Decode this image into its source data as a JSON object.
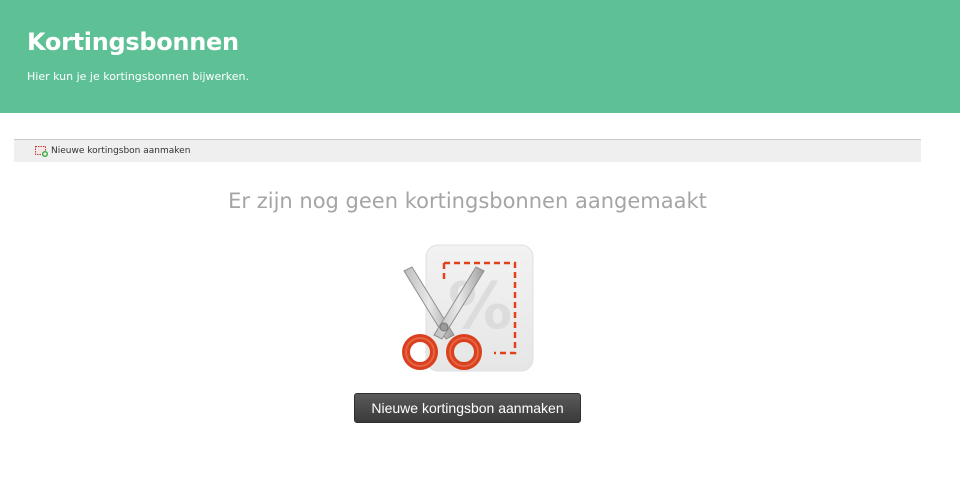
{
  "header": {
    "title": "Kortingsbonnen",
    "subtitle": "Hier kun je je kortingsbonnen bijwerken."
  },
  "toolbar": {
    "new_coupon_label": "Nieuwe kortingsbon aanmaken",
    "new_coupon_icon": "add-coupon-icon"
  },
  "empty_state": {
    "message": "Er zijn nog geen kortingsbonnen aangemaakt",
    "illustration": "scissors-coupon-icon",
    "button_label": "Nieuwe kortingsbon aanmaken"
  },
  "colors": {
    "header_bg": "#5ec196",
    "button_bg": "#444444",
    "scissors_handle": "#d9411e",
    "dashed_line": "#e0421c"
  }
}
